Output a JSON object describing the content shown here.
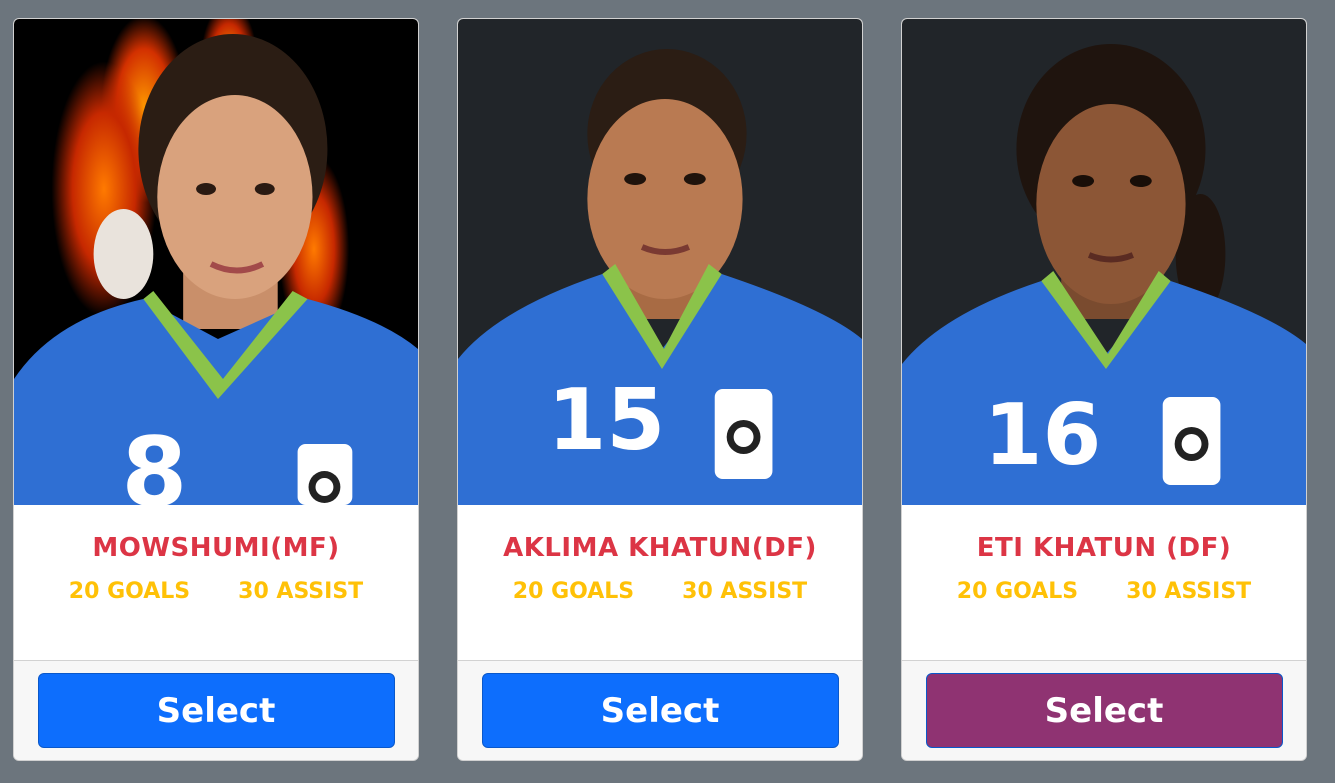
{
  "players": [
    {
      "name": "MOWSHUMI(MF)",
      "goals": "20 GOALS",
      "assist": "30 ASSIST",
      "jersey_number": "8",
      "select_label": "Select",
      "button_color": "#0d6efd",
      "photo_bg": "black"
    },
    {
      "name": "AKLIMA KHATUN(DF)",
      "goals": "20 GOALS",
      "assist": "30 ASSIST",
      "jersey_number": "15",
      "select_label": "Select",
      "button_color": "#0d6efd",
      "photo_bg": "dark"
    },
    {
      "name": "ETI KHATUN (DF)",
      "goals": "20 GOALS",
      "assist": "30 ASSIST",
      "jersey_number": "16",
      "select_label": "Select",
      "button_color": "#8f3372",
      "photo_bg": "dark"
    }
  ],
  "colors": {
    "page_bg": "#6c757d",
    "name_text": "#dc3545",
    "stats_text": "#ffc107",
    "jersey_blue": "#2f6fd3",
    "collar_green": "#8bc34a"
  }
}
